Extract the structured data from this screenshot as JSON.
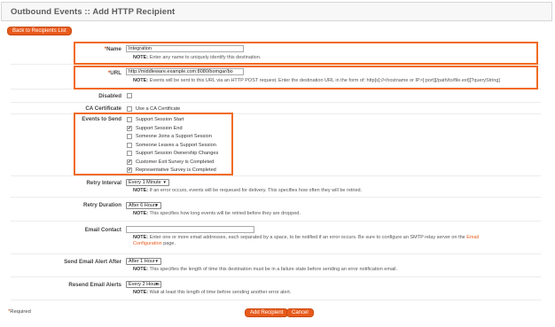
{
  "header": {
    "title": "Outbound Events :: Add HTTP Recipient"
  },
  "back_button": "Back to Recipients List",
  "name": {
    "label": "Name",
    "required_mark": "*",
    "value": "Integration",
    "note_prefix": "NOTE:",
    "note": " Enter any name to uniquely identify this destination."
  },
  "url": {
    "label": "URL",
    "required_mark": "*",
    "value": "http://middleware.example.com:8080/bomgar/bo",
    "note_prefix": "NOTE:",
    "note": " Events will be sent to this URL via an HTTP POST request. Enter the destination URL in the form of: http[s]://<hostname or IP>[:port][/path/to/file.ext][?queryString]"
  },
  "disabled": {
    "label": "Disabled"
  },
  "ca_certificate": {
    "label": "CA Certificate",
    "option": "Use a CA Certificate"
  },
  "events": {
    "label": "Events to Send",
    "items": [
      {
        "label": "Support Session Start",
        "checked": false
      },
      {
        "label": "Support Session End",
        "checked": true
      },
      {
        "label": "Someone Joins a Support Session",
        "checked": false
      },
      {
        "label": "Someone Leaves a Support Session",
        "checked": false
      },
      {
        "label": "Support Session Ownership Changes",
        "checked": false
      },
      {
        "label": "Customer Exit Survey is Completed",
        "checked": true
      },
      {
        "label": "Representative Survey is Completed",
        "checked": true
      }
    ]
  },
  "retry_interval": {
    "label": "Retry Interval",
    "value": "Every 1 Minute",
    "note_prefix": "NOTE:",
    "note": " If an error occurs, events will be requeued for delivery. This specifies how often they will be retried."
  },
  "retry_duration": {
    "label": "Retry Duration",
    "value": "After 6 Hours",
    "note_prefix": "NOTE:",
    "note": " This specifies how long events will be retried before they are dropped."
  },
  "email_contact": {
    "label": "Email Contact",
    "value": "",
    "note_prefix": "NOTE:",
    "note": " Enter one or more email addresses, each separated by a space, to be notified if an error occurs. Be sure to configure an SMTP relay server on the ",
    "note_link": "Email",
    "note_line2_link": "Configuration",
    "note_line2": " page."
  },
  "send_alert_after": {
    "label": "Send Email Alert After",
    "value": "After 1 Hour",
    "note_prefix": "NOTE:",
    "note": " This specifies the length of time this destination must be in a failure state before sending an error notification email."
  },
  "resend_alerts": {
    "label": "Resend Email Alerts",
    "value": "Every 2 Hours",
    "note_prefix": "NOTE:",
    "note": " Wait at least this length of time before sending another error alert."
  },
  "footer": {
    "required_mark": "*",
    "required_label": "Required",
    "add_button": "Add Recipient",
    "cancel_button": "Cancel"
  },
  "colors": {
    "accent": "#e85a1b",
    "highlight": "#f26a22"
  }
}
